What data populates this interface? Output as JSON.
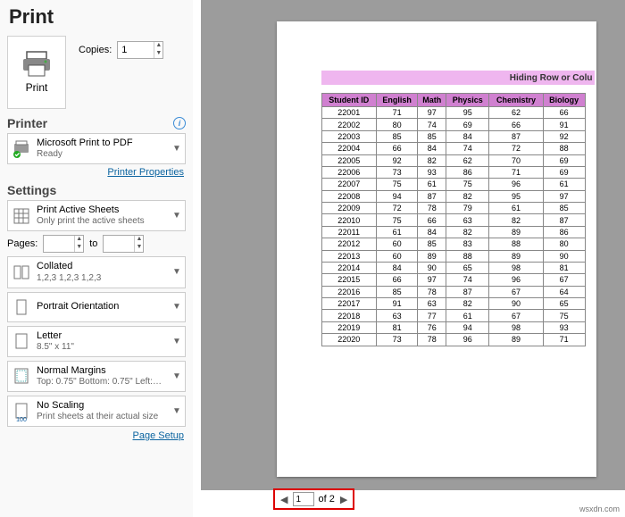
{
  "header": {
    "title": "Print"
  },
  "print_button": {
    "label": "Print"
  },
  "copies": {
    "label": "Copies:",
    "value": "1"
  },
  "printer_section": {
    "label": "Printer"
  },
  "printer": {
    "name": "Microsoft Print to PDF",
    "status": "Ready",
    "properties_link": "Printer Properties"
  },
  "settings_section": {
    "label": "Settings"
  },
  "settings": {
    "what": {
      "main": "Print Active Sheets",
      "sub": "Only print the active sheets"
    },
    "pages": {
      "label": "Pages:",
      "from": "",
      "to_label": "to",
      "to": ""
    },
    "collate": {
      "main": "Collated",
      "sub": "1,2,3    1,2,3    1,2,3"
    },
    "orientation": {
      "main": "Portrait Orientation"
    },
    "paper": {
      "main": "Letter",
      "sub": "8.5\" x 11\""
    },
    "margins": {
      "main": "Normal Margins",
      "sub": "Top: 0.75\" Bottom: 0.75\" Left:…"
    },
    "scaling": {
      "main": "No Scaling",
      "sub": "Print sheets at their actual size",
      "badge": "100"
    },
    "page_setup_link": "Page Setup"
  },
  "preview": {
    "title_bar": "Hiding Row or Colu",
    "headers": [
      "Student ID",
      "English",
      "Math",
      "Physics",
      "Chemistry",
      "Biology"
    ],
    "rows": [
      [
        "22001",
        "71",
        "97",
        "95",
        "62",
        "66"
      ],
      [
        "22002",
        "80",
        "74",
        "69",
        "66",
        "91"
      ],
      [
        "22003",
        "85",
        "85",
        "84",
        "87",
        "92"
      ],
      [
        "22004",
        "66",
        "84",
        "74",
        "72",
        "88"
      ],
      [
        "22005",
        "92",
        "82",
        "62",
        "70",
        "69"
      ],
      [
        "22006",
        "73",
        "93",
        "86",
        "71",
        "69"
      ],
      [
        "22007",
        "75",
        "61",
        "75",
        "96",
        "61"
      ],
      [
        "22008",
        "94",
        "87",
        "82",
        "95",
        "97"
      ],
      [
        "22009",
        "72",
        "78",
        "79",
        "61",
        "85"
      ],
      [
        "22010",
        "75",
        "66",
        "63",
        "82",
        "87"
      ],
      [
        "22011",
        "61",
        "84",
        "82",
        "89",
        "86"
      ],
      [
        "22012",
        "60",
        "85",
        "83",
        "88",
        "80"
      ],
      [
        "22013",
        "60",
        "89",
        "88",
        "89",
        "90"
      ],
      [
        "22014",
        "84",
        "90",
        "65",
        "98",
        "81"
      ],
      [
        "22015",
        "66",
        "97",
        "74",
        "96",
        "67"
      ],
      [
        "22016",
        "85",
        "78",
        "87",
        "67",
        "64"
      ],
      [
        "22017",
        "91",
        "63",
        "82",
        "90",
        "65"
      ],
      [
        "22018",
        "63",
        "77",
        "61",
        "67",
        "75"
      ],
      [
        "22019",
        "81",
        "76",
        "94",
        "98",
        "93"
      ],
      [
        "22020",
        "73",
        "78",
        "96",
        "89",
        "71"
      ]
    ]
  },
  "nav": {
    "current": "1",
    "of_label": "of 2"
  },
  "watermark": "wsxdn.com"
}
